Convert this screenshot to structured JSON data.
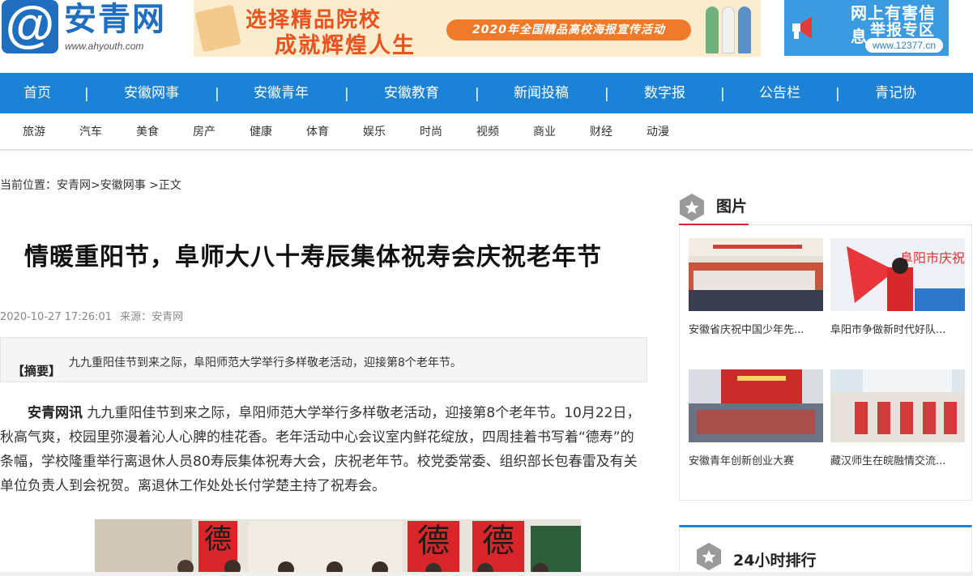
{
  "header": {
    "logo_symbol": "@",
    "logo_name": "安青网",
    "logo_url": "www.ahyouth.com",
    "banner1": {
      "line1": "选择精品院校",
      "line2": "成就辉煌人生",
      "pill": "2020年全国精品高校海报宣传活动"
    },
    "banner2": {
      "line1": "网上有害信息",
      "line2": "举报专区",
      "url": "www.12377.cn"
    }
  },
  "nav": {
    "items": [
      "首页",
      "安徽网事",
      "安徽青年",
      "安徽教育",
      "新闻投稿",
      "数字报",
      "公告栏",
      "青记协"
    ],
    "separator": "|"
  },
  "subnav": {
    "items": [
      "旅游",
      "汽车",
      "美食",
      "房产",
      "健康",
      "体育",
      "娱乐",
      "时尚",
      "视频",
      "商业",
      "财经",
      "动漫"
    ]
  },
  "breadcrumb": {
    "label": "当前位置：",
    "home": "安青网",
    "sep1": ">",
    "section": "安徽网事",
    "sep2": " >",
    "current": "正文"
  },
  "article": {
    "title": "情暖重阳节，阜师大八十寿辰集体祝寿会庆祝老年节",
    "datetime": "2020-10-27 17:26:01",
    "source": "来源：安青网",
    "summary_label": "【摘要】",
    "summary": "九九重阳佳节到来之际，阜阳师范大学举行多样敬老活动，迎接第8个老年节。",
    "lead": "安青网讯",
    "body": " 九九重阳佳节到来之际，阜阳师范大学举行多样敬老活动，迎接第8个老年节。10月22日，秋高气爽，校园里弥漫着沁人心脾的桂花香。老年活动中心会议室内鲜花绽放，四周挂着书写着“德寿”的条幅，学校隆重举行离退休人员80寿辰集体祝寿大会，庆祝老年节。校党委常委、组织部长包春雷及有关单位负责人到会祝贺。离退休工作处处长付学楚主持了祝寿会。"
  },
  "sidebar": {
    "pictures_title": "图片",
    "pictures": [
      {
        "caption": "安徽省庆祝中国少年先..."
      },
      {
        "caption": "阜阳市争做新时代好队..."
      },
      {
        "caption": "安徽青年创新创业大赛"
      },
      {
        "caption": "藏汉师生在皖融情交流..."
      }
    ],
    "ranking_title": "24小时排行"
  },
  "colors": {
    "nav_blue": "#1c82d6",
    "accent_red": "#d9282b",
    "banner_orange": "#e8531f"
  }
}
